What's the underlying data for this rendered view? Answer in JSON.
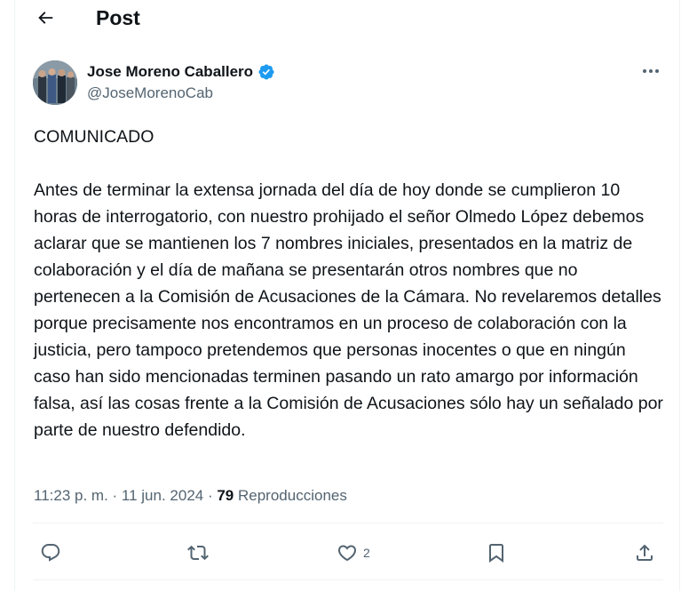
{
  "header": {
    "title": "Post"
  },
  "author": {
    "name": "Jose Moreno Caballero",
    "handle": "@JoseMorenoCab",
    "verified": true,
    "verified_color": "#1d9bf0"
  },
  "tweet": {
    "text": "COMUNICADO\n\nAntes de terminar la extensa jornada del día de hoy donde se cumplieron 10 horas de interrogatorio, con nuestro prohijado el señor Olmedo López debemos aclarar que se mantienen los 7 nombres iniciales, presentados en la matriz de colaboración y el día de mañana se presentarán otros nombres que no pertenecen a la Comisión de Acusaciones de la Cámara. No revelaremos detalles porque precisamente nos encontramos en un proceso de colaboración con la justicia, pero tampoco pretendemos que personas inocentes o que en ningún caso han sido mencionadas terminen pasando un rato amargo por información falsa, así las cosas frente a la Comisión de Acusaciones sólo hay un señalado por parte de nuestro defendido."
  },
  "meta": {
    "time": "11:23 p. m.",
    "separator": " · ",
    "date": "11 jun. 2024",
    "views_count": "79",
    "views_label": "Reproducciones"
  },
  "actions": {
    "reply_icon": "reply-icon",
    "retweet_icon": "retweet-icon",
    "like_icon": "heart-icon",
    "like_count": "2",
    "bookmark_icon": "bookmark-icon",
    "share_icon": "share-icon"
  },
  "colors": {
    "text_primary": "#0f1419",
    "text_secondary": "#536471",
    "divider": "#eff3f4",
    "verified": "#1d9bf0"
  }
}
